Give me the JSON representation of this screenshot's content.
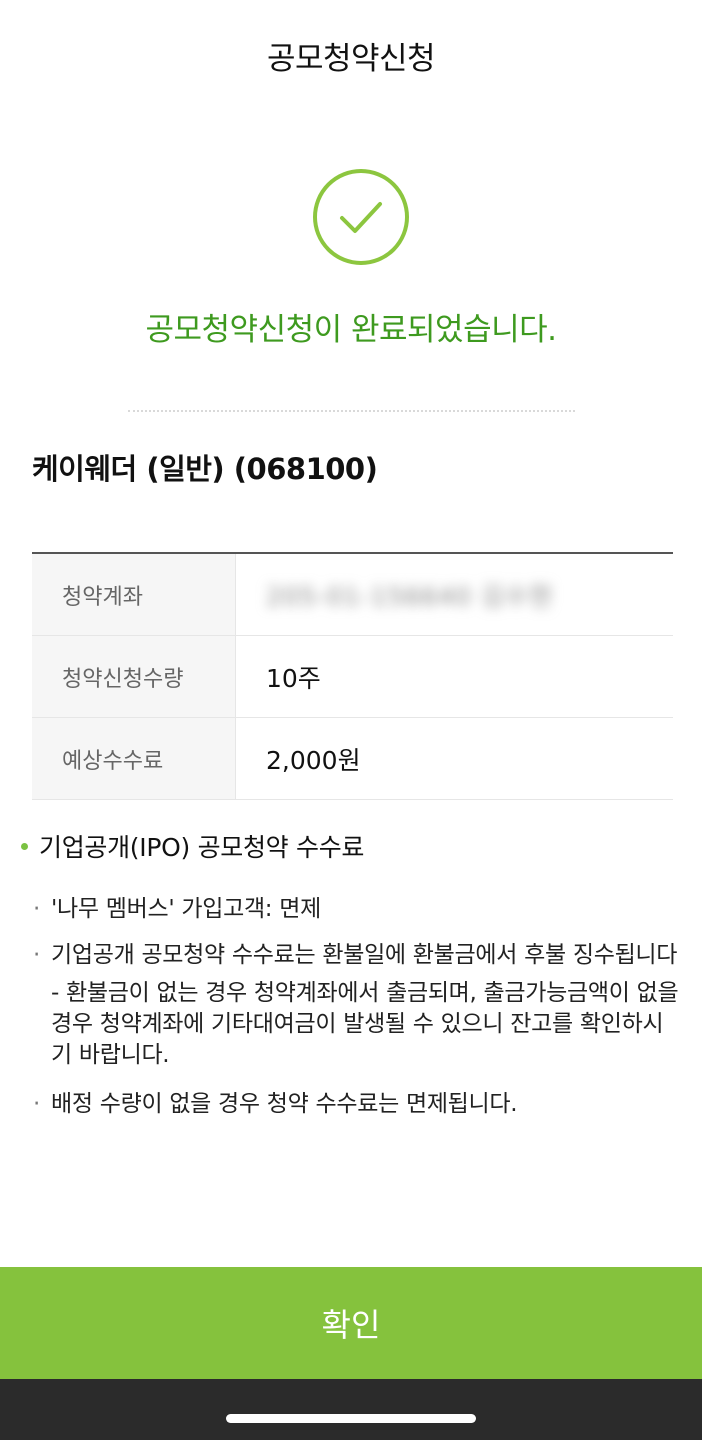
{
  "header": {
    "title": "공모청약신청"
  },
  "result": {
    "icon": "check-circle-icon",
    "message": "공모청약신청이 완료되었습니다.",
    "accent_color": "#3e9a1f"
  },
  "stock": {
    "name": "케이웨더 (일반) (068100)"
  },
  "table": {
    "rows": [
      {
        "label": "청약계좌",
        "value": "205-01-156640 김수현"
      },
      {
        "label": "청약신청수량",
        "value": "10주"
      },
      {
        "label": "예상수수료",
        "value": "2,000원"
      }
    ]
  },
  "notice": {
    "title": "기업공개(IPO) 공모청약 수수료",
    "items": [
      "'나무 멤버스' 가입고객: 면제",
      "기업공개 공모청약 수수료는 환불일에 환불금에서 후불 징수됩니다",
      "배정 수량이 없을 경우 청약 수수료는 면제됩니다."
    ],
    "sub_item": "- 환불금이 없는 경우 청약계좌에서 출금되며, 출금가능금액이 없을 경우 청약계좌에 기타대여금이 발생될 수 있으니 잔고를 확인하시기 바랍니다.",
    "bullet": "·"
  },
  "footer": {
    "confirm_label": "확인",
    "button_color": "#85c23d"
  }
}
